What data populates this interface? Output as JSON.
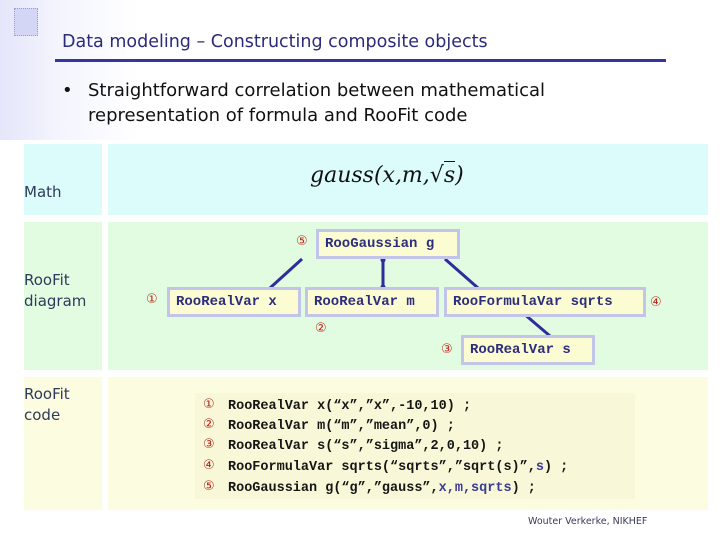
{
  "slide": {
    "title": "Data modeling – Constructing composite objects",
    "bullet": {
      "marker": "•",
      "lines": [
        "Straightforward correlation between mathematical",
        "representation of formula and RooFit code"
      ]
    },
    "footer": "Wouter Verkerke, NIKHEF"
  },
  "colors": {
    "title": "#2b2b7a",
    "rule": "#3535a0",
    "math_row": "#dcfcfc",
    "diagram_row": "#e2fce2",
    "code_row": "#fcfce0",
    "node_fill": "#fcfcd2",
    "node_border": "#c2c4ea",
    "node_text": "#2d2d7c",
    "arrow": "#2d2d9c",
    "step_number": "#c0281e"
  },
  "rows": {
    "math": {
      "label": "Math",
      "formula": {
        "prefix": "gauss(x,m,",
        "radical": "√",
        "radicand": "s",
        "suffix": ")"
      }
    },
    "diagram": {
      "label_line1": "RooFit",
      "label_line2": "diagram",
      "nodes": {
        "gaussian": {
          "step": "⑤",
          "label": "RooGaussian g"
        },
        "x": {
          "step": "①",
          "label": "RooRealVar x"
        },
        "m": {
          "step": "②",
          "label": "RooRealVar m"
        },
        "sqrts": {
          "step": "④",
          "label": "RooFormulaVar sqrts"
        },
        "s": {
          "step": "③",
          "label": "RooRealVar s"
        }
      }
    },
    "code": {
      "label_line1": "RooFit",
      "label_line2": "code",
      "lines": [
        {
          "step": "①",
          "text": "RooRealVar x(“x”,”x”,-10,10) ;",
          "args": ""
        },
        {
          "step": "②",
          "text": "RooRealVar m(“m”,”mean”,0) ;",
          "args": ""
        },
        {
          "step": "③",
          "text": "RooRealVar s(“s”,”sigma”,2,0,10) ;",
          "args": ""
        },
        {
          "step": "④",
          "pre": "RooFormulaVar sqrts(“sqrts”,”sqrt(s)”,",
          "args": "s",
          "post": ") ;"
        },
        {
          "step": "⑤",
          "pre": "RooGaussian g(“g”,”gauss”,",
          "args": "x,m,sqrts",
          "post": ") ;"
        }
      ]
    }
  }
}
